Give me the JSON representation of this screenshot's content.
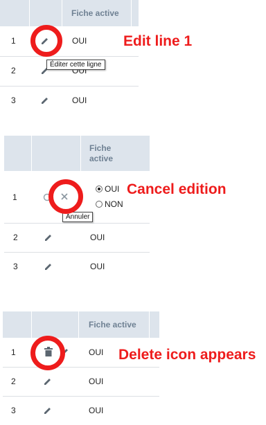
{
  "panel1": {
    "header": "Fiche active",
    "rows": [
      {
        "num": "1",
        "value": "OUI"
      },
      {
        "num": "2",
        "value": "OUI"
      },
      {
        "num": "3",
        "value": "OUI"
      }
    ],
    "tooltip": "Éditer cette ligne",
    "annotation": "Edit line 1"
  },
  "panel2": {
    "header": "Fiche active",
    "rows": [
      {
        "num": "1",
        "value": ""
      },
      {
        "num": "2",
        "value": "OUI"
      },
      {
        "num": "3",
        "value": "OUI"
      }
    ],
    "radio_oui": "OUI",
    "radio_non": "NON",
    "tooltip": "Annuler",
    "annotation": "Cancel edition"
  },
  "panel3": {
    "header": "Fiche active",
    "rows": [
      {
        "num": "1",
        "value": "OUI"
      },
      {
        "num": "2",
        "value": "OUI"
      },
      {
        "num": "3",
        "value": "OUI"
      }
    ],
    "annotation": "Delete icon appears"
  },
  "colors": {
    "accent": "#ee1c1c",
    "header_bg": "#dde4ec",
    "header_text": "#6f8193"
  }
}
